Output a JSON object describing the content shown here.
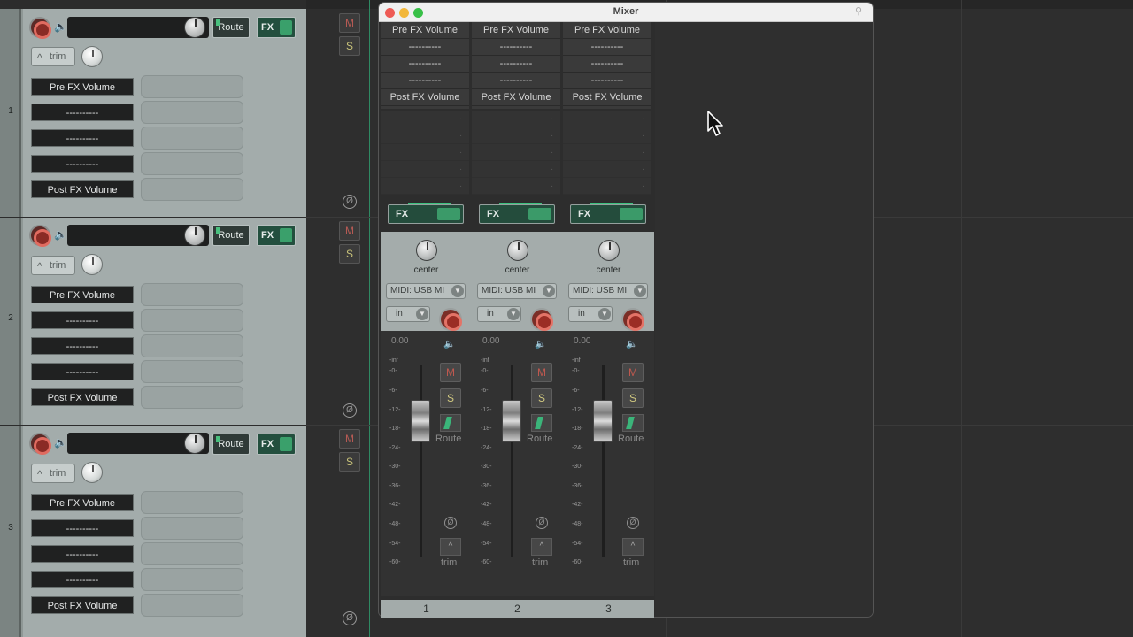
{
  "tracks": [
    {
      "number": "1",
      "route_label": "Route",
      "fx_label": "FX",
      "trim_label": "trim",
      "envelopes": [
        "Pre FX Volume",
        "----------",
        "----------",
        "----------",
        "Post FX Volume"
      ]
    },
    {
      "number": "2",
      "route_label": "Route",
      "fx_label": "FX",
      "trim_label": "trim",
      "envelopes": [
        "Pre FX Volume",
        "----------",
        "----------",
        "----------",
        "Post FX Volume"
      ]
    },
    {
      "number": "3",
      "route_label": "Route",
      "fx_label": "FX",
      "trim_label": "trim",
      "envelopes": [
        "Pre FX Volume",
        "----------",
        "----------",
        "----------",
        "Post FX Volume"
      ]
    }
  ],
  "mcp_buttons": {
    "mute": "M",
    "solo": "S",
    "phase": "Ø"
  },
  "mixer": {
    "title": "Mixer",
    "strips": [
      {
        "number": "1",
        "fx": [
          "Pre FX Volume",
          "----------",
          "----------",
          "----------",
          "Post FX Volume"
        ],
        "fx_button": "FX",
        "pan_label": "center",
        "midi_input": "MIDI: USB MI",
        "input_mode": "in",
        "volume": "0.00",
        "mute": "M",
        "solo": "S",
        "route": "Route",
        "phase": "Ø",
        "trim": "trim"
      },
      {
        "number": "2",
        "fx": [
          "Pre FX Volume",
          "----------",
          "----------",
          "----------",
          "Post FX Volume"
        ],
        "fx_button": "FX",
        "pan_label": "center",
        "midi_input": "MIDI: USB MI",
        "input_mode": "in",
        "volume": "0.00",
        "mute": "M",
        "solo": "S",
        "route": "Route",
        "phase": "Ø",
        "trim": "trim"
      },
      {
        "number": "3",
        "fx": [
          "Pre FX Volume",
          "----------",
          "----------",
          "----------",
          "Post FX Volume"
        ],
        "fx_button": "FX",
        "pan_label": "center",
        "midi_input": "MIDI: USB MI",
        "input_mode": "in",
        "volume": "0.00",
        "mute": "M",
        "solo": "S",
        "route": "Route",
        "phase": "Ø",
        "trim": "trim"
      }
    ],
    "meter_scale": [
      "-inf",
      "-0-",
      "-6-",
      "-12-",
      "-18-",
      "-24-",
      "-30-",
      "-36-",
      "-42-",
      "-48-",
      "-54-",
      "-60-"
    ]
  },
  "colors": {
    "accent_green": "#3cc27f",
    "record_red": "#e06b60",
    "mute_red": "#c0594f",
    "solo_yellow": "#cfc77f"
  }
}
